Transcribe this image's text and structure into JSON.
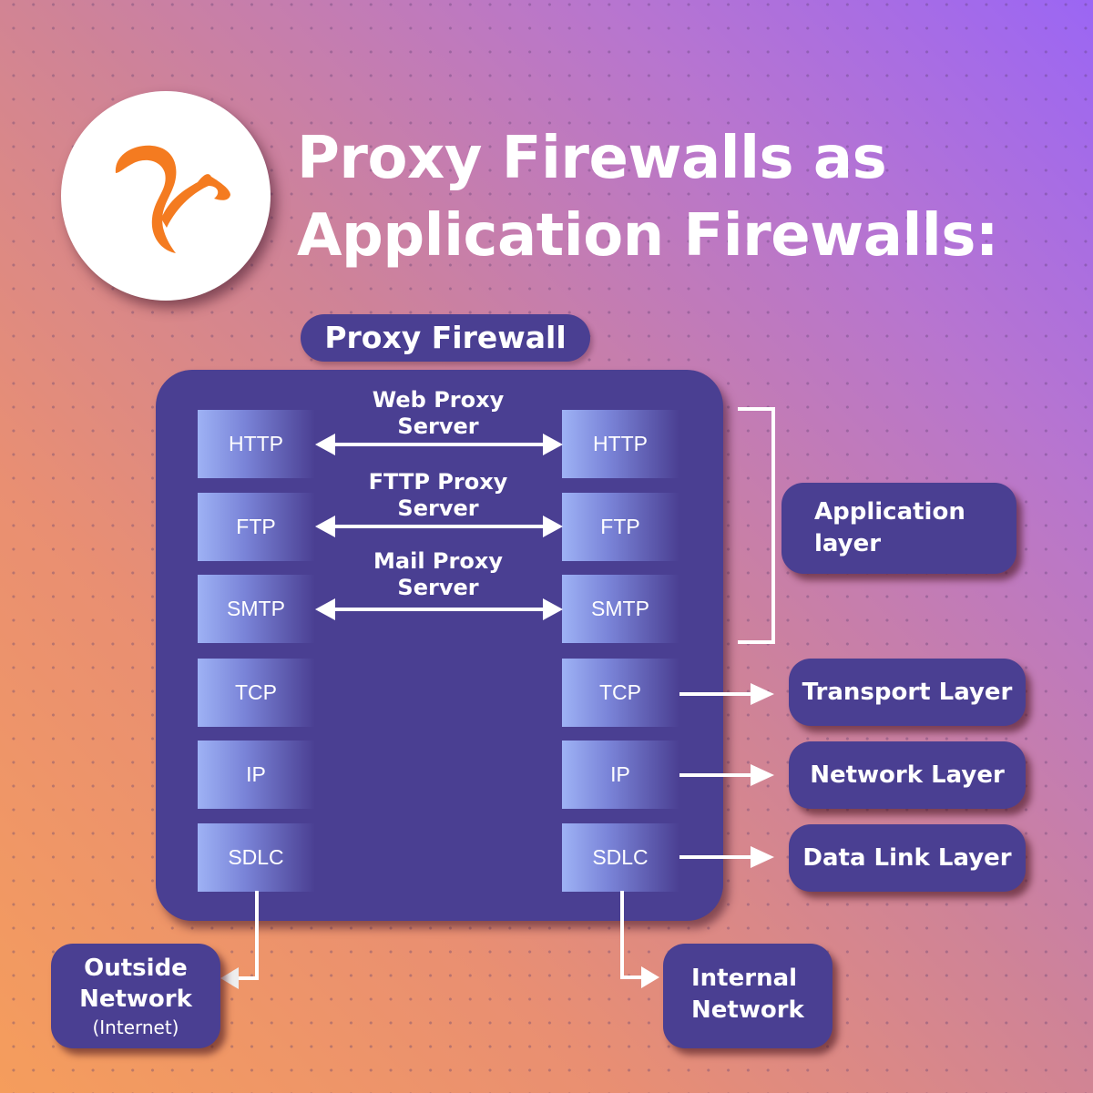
{
  "title": {
    "line1": "Proxy Firewalls as",
    "line2": "Application Firewalls:"
  },
  "logo": {
    "icon": "squirrel-logo-icon",
    "color": "#f47b20"
  },
  "firewall": {
    "label": "Proxy Firewall",
    "left_stack": [
      "HTTP",
      "FTP",
      "SMTP",
      "TCP",
      "IP",
      "SDLC"
    ],
    "right_stack": [
      "HTTP",
      "FTP",
      "SMTP",
      "TCP",
      "IP",
      "SDLC"
    ],
    "proxy_servers": [
      {
        "line1": "Web Proxy",
        "line2": "Server"
      },
      {
        "line1": "FTTP Proxy",
        "line2": "Server"
      },
      {
        "line1": "Mail Proxy",
        "line2": "Server"
      }
    ]
  },
  "layers": {
    "application": {
      "line1": "Application",
      "line2": "layer"
    },
    "transport": "Transport Layer",
    "network": "Network Layer",
    "datalink": "Data Link Layer"
  },
  "networks": {
    "outside": {
      "line1": "Outside",
      "line2": "Network",
      "line3": "(Internet)"
    },
    "internal": {
      "line1": "Internal",
      "line2": "Network"
    }
  },
  "colors": {
    "panel": "#4a3f92",
    "gradient_top_right": "#9b66f4",
    "gradient_bottom_left": "#f59d5c",
    "logo_orange": "#f47b20",
    "protocol_light": "#9eb2f5"
  }
}
